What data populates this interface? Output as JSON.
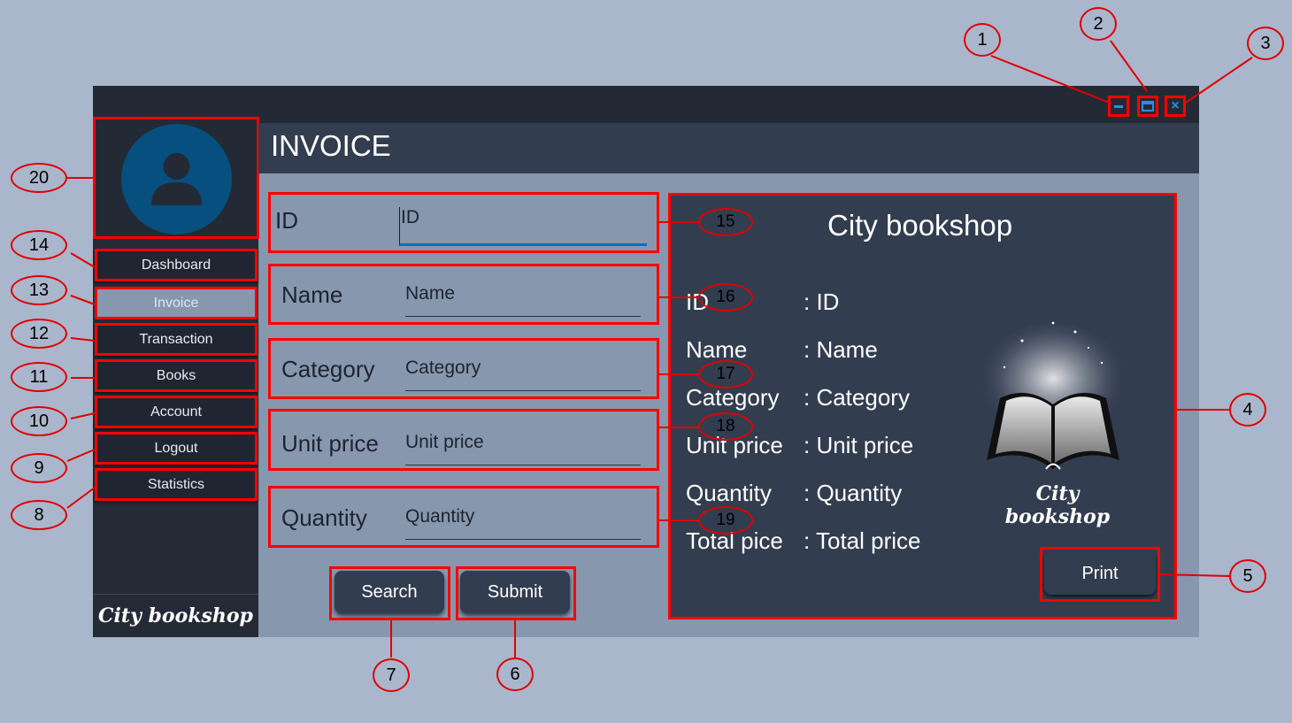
{
  "window": {
    "title": "INVOICE",
    "controls": {
      "minimize_icon": "minimize-icon",
      "maximize_icon": "maximize-icon",
      "close_icon": "close-icon",
      "close_glyph": "×"
    }
  },
  "sidebar": {
    "brand": "City bookshop",
    "items": [
      {
        "label": "Dashboard"
      },
      {
        "label": "Invoice"
      },
      {
        "label": "Transaction"
      },
      {
        "label": "Books"
      },
      {
        "label": "Account"
      },
      {
        "label": "Logout"
      },
      {
        "label": "Statistics"
      }
    ]
  },
  "form": {
    "fields": [
      {
        "label": "ID",
        "value": "ID"
      },
      {
        "label": "Name",
        "value": "Name"
      },
      {
        "label": "Category",
        "value": "Category"
      },
      {
        "label": "Unit price",
        "value": "Unit price"
      },
      {
        "label": "Quantity",
        "value": "Quantity"
      }
    ],
    "search_label": "Search",
    "submit_label": "Submit"
  },
  "invoice": {
    "title": "City bookshop",
    "rows": [
      {
        "label": "ID",
        "value": ": ID"
      },
      {
        "label": "Name",
        "value": ": Name"
      },
      {
        "label": "Category",
        "value": ": Category"
      },
      {
        "label": "Unit price",
        "value": ": Unit price"
      },
      {
        "label": "Quantity",
        "value": ": Quantity"
      },
      {
        "label": "Total pice",
        "value": ": Total price"
      }
    ],
    "logo_text": "City bookshop",
    "print_label": "Print"
  },
  "callouts": [
    "1",
    "2",
    "3",
    "4",
    "5",
    "6",
    "7",
    "8",
    "9",
    "10",
    "11",
    "12",
    "13",
    "14",
    "15",
    "16",
    "17",
    "18",
    "19",
    "20"
  ],
  "colors": {
    "annotation": "#ff0000",
    "accent": "#2a8fe0",
    "panel": "#323d50",
    "sidebar": "#242b37"
  }
}
